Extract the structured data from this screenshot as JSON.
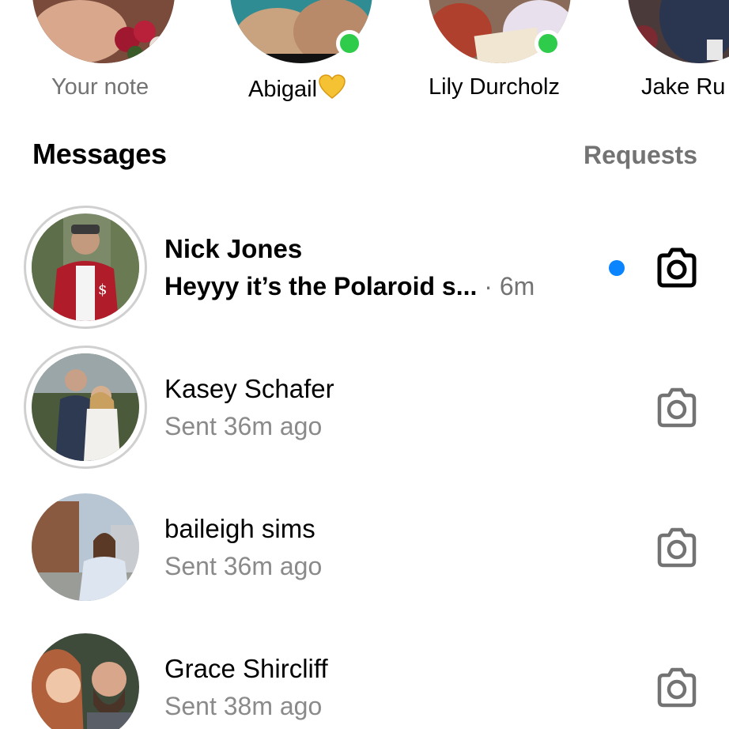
{
  "notes": [
    {
      "name": "Your note",
      "online": false
    },
    {
      "name": "Abigail",
      "emoji": "yellow-heart-emoji",
      "online": true
    },
    {
      "name": "Lily Durcholz",
      "online": true
    },
    {
      "name": "Jake Ru",
      "online": false
    }
  ],
  "header": {
    "title": "Messages",
    "requests_label": "Requests"
  },
  "conversations": [
    {
      "name": "Nick Jones",
      "preview": "Heyyy it’s the Polaroid s...",
      "time": "· 6m",
      "unread": true,
      "story_ring": true
    },
    {
      "name": "Kasey Schafer",
      "preview": "Sent 36m ago",
      "unread": false,
      "story_ring": true
    },
    {
      "name": "baileigh sims",
      "preview": "Sent 36m ago",
      "unread": false,
      "story_ring": false
    },
    {
      "name": "Grace Shircliff",
      "preview": "Sent 38m ago",
      "unread": false,
      "story_ring": false
    }
  ],
  "icons": {
    "camera": "camera-icon",
    "online": "online-indicator",
    "unread": "unread-dot"
  },
  "colors": {
    "online_green": "#2fcc4b",
    "unread_blue": "#0a84ff",
    "muted_text": "#737373",
    "preview_gray": "#8a8a8a",
    "ring_gray": "#d0d0d0"
  }
}
